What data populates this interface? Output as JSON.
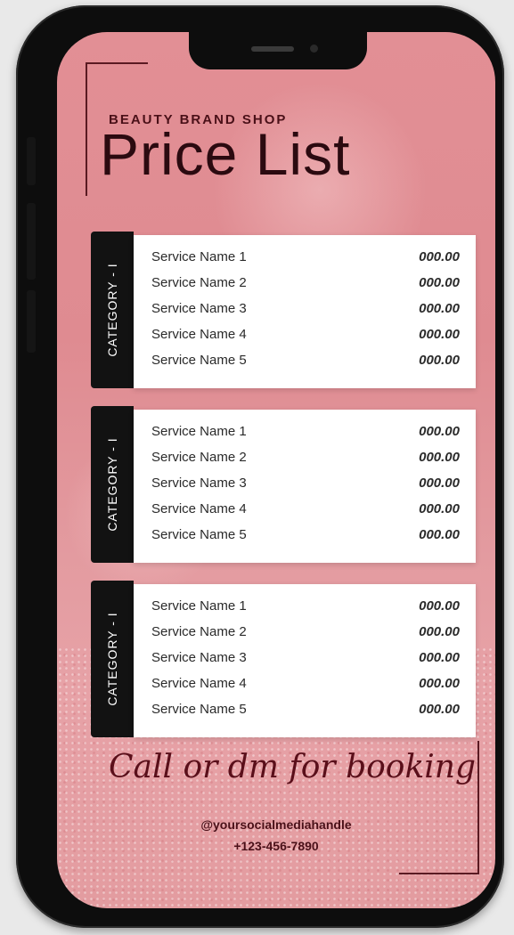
{
  "brand": "BEAUTY BRAND SHOP",
  "title": "Price List",
  "categories": [
    {
      "label": "CATEGORY - I",
      "services": [
        {
          "name": "Service Name 1",
          "price": "000.00"
        },
        {
          "name": "Service Name 2",
          "price": "000.00"
        },
        {
          "name": "Service Name 3",
          "price": "000.00"
        },
        {
          "name": "Service Name 4",
          "price": "000.00"
        },
        {
          "name": "Service Name 5",
          "price": "000.00"
        }
      ]
    },
    {
      "label": "CATEGORY - I",
      "services": [
        {
          "name": "Service Name 1",
          "price": "000.00"
        },
        {
          "name": "Service Name 2",
          "price": "000.00"
        },
        {
          "name": "Service Name 3",
          "price": "000.00"
        },
        {
          "name": "Service Name 4",
          "price": "000.00"
        },
        {
          "name": "Service Name 5",
          "price": "000.00"
        }
      ]
    },
    {
      "label": "CATEGORY - I",
      "services": [
        {
          "name": "Service Name 1",
          "price": "000.00"
        },
        {
          "name": "Service Name 2",
          "price": "000.00"
        },
        {
          "name": "Service Name 3",
          "price": "000.00"
        },
        {
          "name": "Service Name 4",
          "price": "000.00"
        },
        {
          "name": "Service Name 5",
          "price": "000.00"
        }
      ]
    }
  ],
  "cta": "Call or dm for booking",
  "social_handle": "@yoursocialmediahandle",
  "phone": "+123-456-7890",
  "colors": {
    "accent_dark": "#2b0a10",
    "category_tab": "#121212",
    "background_pink": "#e28f95"
  }
}
